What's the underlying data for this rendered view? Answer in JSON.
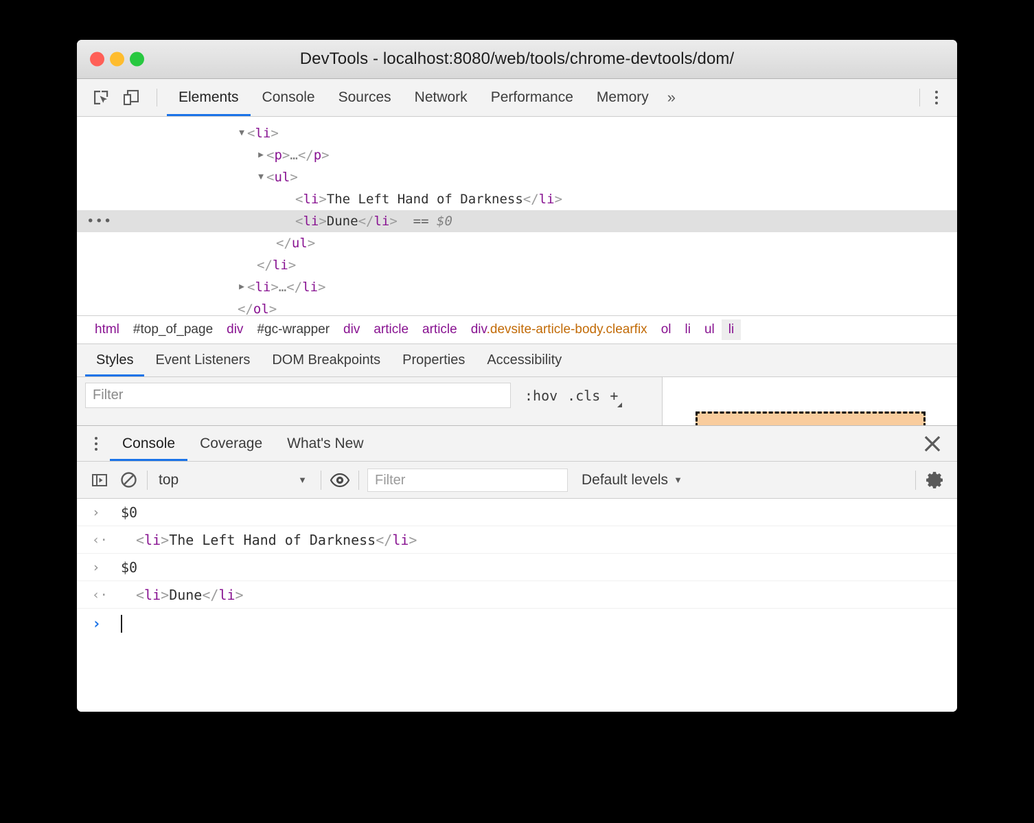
{
  "window": {
    "title": "DevTools - localhost:8080/web/tools/chrome-devtools/dom/",
    "traffic_lights": {
      "close": "#ff5f57",
      "minimize": "#febc2e",
      "zoom": "#28c840"
    }
  },
  "toolbar": {
    "inspect_icon": "inspect-element-icon",
    "device_icon": "device-toolbar-icon",
    "tabs": [
      {
        "label": "Elements",
        "active": true
      },
      {
        "label": "Console",
        "active": false
      },
      {
        "label": "Sources",
        "active": false
      },
      {
        "label": "Network",
        "active": false
      },
      {
        "label": "Performance",
        "active": false
      },
      {
        "label": "Memory",
        "active": false
      }
    ],
    "more_tabs": "»",
    "menu_icon": "more-options-kebab-icon",
    "accent": "#1a73e8"
  },
  "dom_tree": {
    "rows": [
      {
        "indent": 220,
        "arrow": "▼",
        "badge": "",
        "selected": false,
        "parts": [
          {
            "t": "brk",
            "v": "<"
          },
          {
            "t": "tag",
            "v": "li"
          },
          {
            "t": "brk",
            "v": ">"
          }
        ]
      },
      {
        "indent": 248,
        "arrow": "▶",
        "badge": "",
        "selected": false,
        "parts": [
          {
            "t": "brk",
            "v": "<"
          },
          {
            "t": "tag",
            "v": "p"
          },
          {
            "t": "brk",
            "v": ">"
          },
          {
            "t": "dots",
            "v": "…"
          },
          {
            "t": "brk",
            "v": "</"
          },
          {
            "t": "tag",
            "v": "p"
          },
          {
            "t": "brk",
            "v": ">"
          }
        ]
      },
      {
        "indent": 248,
        "arrow": "▼",
        "badge": "",
        "selected": false,
        "parts": [
          {
            "t": "brk",
            "v": "<"
          },
          {
            "t": "tag",
            "v": "ul"
          },
          {
            "t": "brk",
            "v": ">"
          }
        ]
      },
      {
        "indent": 290,
        "arrow": "",
        "badge": "",
        "selected": false,
        "parts": [
          {
            "t": "brk",
            "v": "<"
          },
          {
            "t": "tag",
            "v": "li"
          },
          {
            "t": "brk",
            "v": ">"
          },
          {
            "t": "txt",
            "v": "The Left Hand of Darkness"
          },
          {
            "t": "brk",
            "v": "</"
          },
          {
            "t": "tag",
            "v": "li"
          },
          {
            "t": "brk",
            "v": ">"
          }
        ]
      },
      {
        "indent": 290,
        "arrow": "",
        "badge": "•••",
        "selected": true,
        "parts": [
          {
            "t": "brk",
            "v": "<"
          },
          {
            "t": "tag",
            "v": "li"
          },
          {
            "t": "brk",
            "v": ">"
          },
          {
            "t": "txt",
            "v": "Dune"
          },
          {
            "t": "brk",
            "v": "</"
          },
          {
            "t": "tag",
            "v": "li"
          },
          {
            "t": "brk",
            "v": ">"
          },
          {
            "t": "eq",
            "v": "  =="
          },
          {
            "t": "dollar",
            "v": " $0"
          }
        ]
      },
      {
        "indent": 262,
        "arrow": "",
        "badge": "",
        "selected": false,
        "parts": [
          {
            "t": "brk",
            "v": "</"
          },
          {
            "t": "tag",
            "v": "ul"
          },
          {
            "t": "brk",
            "v": ">"
          }
        ]
      },
      {
        "indent": 234,
        "arrow": "",
        "badge": "",
        "selected": false,
        "parts": [
          {
            "t": "brk",
            "v": "</"
          },
          {
            "t": "tag",
            "v": "li"
          },
          {
            "t": "brk",
            "v": ">"
          }
        ]
      },
      {
        "indent": 220,
        "arrow": "▶",
        "badge": "",
        "selected": false,
        "parts": [
          {
            "t": "brk",
            "v": "<"
          },
          {
            "t": "tag",
            "v": "li"
          },
          {
            "t": "brk",
            "v": ">"
          },
          {
            "t": "dots",
            "v": "…"
          },
          {
            "t": "brk",
            "v": "</"
          },
          {
            "t": "tag",
            "v": "li"
          },
          {
            "t": "brk",
            "v": ">"
          }
        ]
      },
      {
        "indent": 206,
        "arrow": "",
        "badge": "",
        "selected": false,
        "parts": [
          {
            "t": "brk",
            "v": "</"
          },
          {
            "t": "tag",
            "v": "ol"
          },
          {
            "t": "brk",
            "v": ">"
          }
        ]
      }
    ]
  },
  "breadcrumb": {
    "items": [
      {
        "label": "html",
        "kind": "tag",
        "selected": false
      },
      {
        "label": "#top_of_page",
        "kind": "id",
        "selected": false
      },
      {
        "label": "div",
        "kind": "tag",
        "selected": false
      },
      {
        "label": "#gc-wrapper",
        "kind": "id",
        "selected": false
      },
      {
        "label": "div",
        "kind": "tag",
        "selected": false
      },
      {
        "label": "article",
        "kind": "tag",
        "selected": false
      },
      {
        "label": "article",
        "kind": "tag",
        "selected": false
      },
      {
        "label": "div",
        "kind": "tag",
        "selected": false,
        "classes": ".devsite-article-body.clearfix"
      },
      {
        "label": "ol",
        "kind": "tag",
        "selected": false
      },
      {
        "label": "li",
        "kind": "tag",
        "selected": false
      },
      {
        "label": "ul",
        "kind": "tag",
        "selected": false
      },
      {
        "label": "li",
        "kind": "tag",
        "selected": true
      }
    ]
  },
  "sidebar_tabs": {
    "items": [
      {
        "label": "Styles",
        "active": true
      },
      {
        "label": "Event Listeners",
        "active": false
      },
      {
        "label": "DOM Breakpoints",
        "active": false
      },
      {
        "label": "Properties",
        "active": false
      },
      {
        "label": "Accessibility",
        "active": false
      }
    ]
  },
  "styles_pane": {
    "filter_placeholder": "Filter",
    "filter_value": "",
    "hov_label": ":hov",
    "cls_label": ".cls",
    "new_rule_label": "+",
    "box_model_color": "#f9cc9d"
  },
  "drawer": {
    "tabs": [
      {
        "label": "Console",
        "active": true
      },
      {
        "label": "Coverage",
        "active": false
      },
      {
        "label": "What's New",
        "active": false
      }
    ],
    "menu_icon": "more-options-kebab-icon",
    "close_icon": "close-icon",
    "console_toolbar": {
      "sidebar_icon": "console-sidebar-toggle-icon",
      "clear_icon": "clear-console-icon",
      "context_value": "top",
      "context_caret": "▼",
      "eye_icon": "live-expression-eye-icon",
      "filter_placeholder": "Filter",
      "filter_value": "",
      "levels_label": "Default levels",
      "levels_caret": "▼",
      "settings_icon": "settings-gear-icon"
    },
    "messages": [
      {
        "type": "input",
        "gutter": "›",
        "parts": [
          {
            "t": "txt",
            "v": "$0"
          }
        ]
      },
      {
        "type": "result",
        "gutter": "‹·",
        "parts": [
          {
            "t": "brk",
            "v": "<"
          },
          {
            "t": "tag",
            "v": "li"
          },
          {
            "t": "brk",
            "v": ">"
          },
          {
            "t": "txt",
            "v": "The Left Hand of Darkness"
          },
          {
            "t": "brk",
            "v": "</"
          },
          {
            "t": "tag",
            "v": "li"
          },
          {
            "t": "brk",
            "v": ">"
          }
        ]
      },
      {
        "type": "input",
        "gutter": "›",
        "parts": [
          {
            "t": "txt",
            "v": "$0"
          }
        ]
      },
      {
        "type": "result",
        "gutter": "‹·",
        "parts": [
          {
            "t": "brk",
            "v": "<"
          },
          {
            "t": "tag",
            "v": "li"
          },
          {
            "t": "brk",
            "v": ">"
          },
          {
            "t": "txt",
            "v": "Dune"
          },
          {
            "t": "brk",
            "v": "</"
          },
          {
            "t": "tag",
            "v": "li"
          },
          {
            "t": "brk",
            "v": ">"
          }
        ]
      }
    ],
    "prompt": {
      "gutter": "›",
      "value": ""
    }
  }
}
